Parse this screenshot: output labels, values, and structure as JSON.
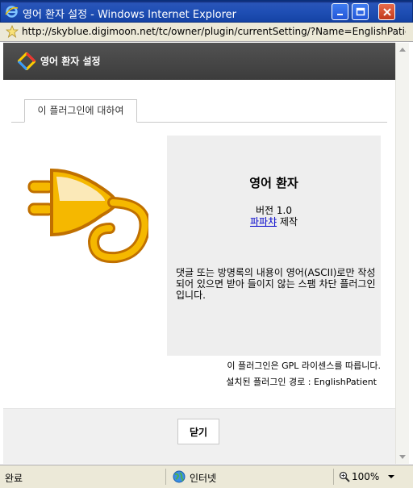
{
  "window": {
    "title": "영어 환자 설정 - Windows Internet Explorer"
  },
  "address": {
    "url": "http://skyblue.digimoon.net/tc/owner/plugin/currentSetting/?Name=EnglishPatie"
  },
  "header": {
    "title": "영어 환자 설정"
  },
  "tabs": [
    {
      "label": "이 플러그인에 대하여",
      "active": true
    }
  ],
  "plugin": {
    "name": "영어 환자",
    "version": "버전 1.0",
    "author": "파파챠",
    "author_suffix": " 제작",
    "description": "댓글 또는 방명록의 내용이 영어(ASCII)로만 작성되어 있으면 받아 들이지 않는 스팸 차단 플러그인입니다.",
    "license": "이 플러그인은 GPL 라이센스를 따릅니다.",
    "install_path": "설치된 플러그인 경로 : EnglishPatient"
  },
  "footer": {
    "close_label": "닫기"
  },
  "statusbar": {
    "status": "완료",
    "zone": "인터넷",
    "zoom": "100%"
  },
  "colors": {
    "titlebar": "#1f4fb5",
    "header_bg": "#444444",
    "infobox_bg": "#eeeeee",
    "plug_yellow": "#f5b800",
    "plug_orange": "#e07800"
  }
}
